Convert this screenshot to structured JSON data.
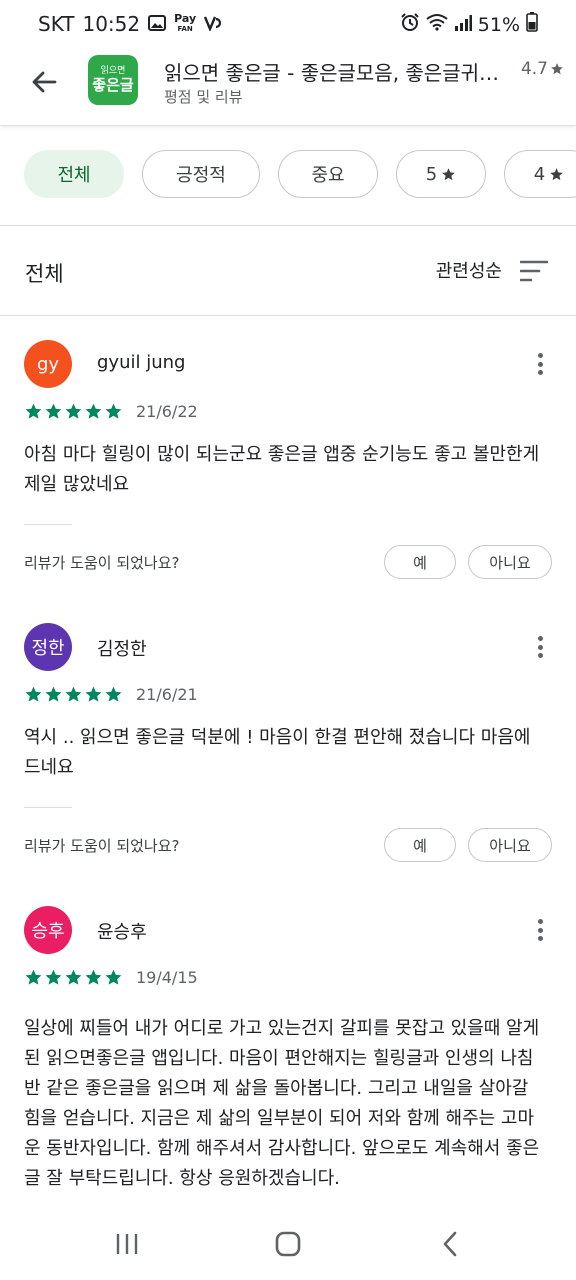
{
  "status_bar": {
    "carrier": "SKT",
    "time": "10:52",
    "pay_line1": "Pay",
    "pay_line2": "FAN",
    "battery": "51%"
  },
  "header": {
    "app_title": "읽으면 좋은글 - 좋은글모음, 좋은글귀, 명언",
    "subtitle": "평점 및 리뷰",
    "rating": "4.7",
    "app_icon_line1": "읽으면",
    "app_icon_line2": "좋은글"
  },
  "chips": [
    {
      "label": "전체",
      "selected": true
    },
    {
      "label": "긍정적"
    },
    {
      "label": "중요"
    },
    {
      "label": "5"
    },
    {
      "label": "4"
    }
  ],
  "sort": {
    "title": "전체",
    "label": "관련성순"
  },
  "helpful": {
    "question": "리뷰가 도움이 되었나요?",
    "yes": "예",
    "no": "아니요"
  },
  "reviews": [
    {
      "avatar_text": "gy",
      "avatar_color": "#f4511e",
      "name": "gyuil jung",
      "rating": 5,
      "date": "21/6/22",
      "text": "아침 마다 힐링이 많이 되는군요 좋은글 앱중 순기능도 좋고 볼만한게 제일 많았네요"
    },
    {
      "avatar_text": "정한",
      "avatar_color": "#5e35b1",
      "name": "김정한",
      "rating": 5,
      "date": "21/6/21",
      "text": "역시 .. 읽으면 좋은글 덕분에 ! 마음이 한결 편안해 졌습니다 마음에 드네요"
    },
    {
      "avatar_text": "승후",
      "avatar_color": "#e91e63",
      "name": "윤승후",
      "rating": 5,
      "date": "19/4/15",
      "text": "일상에 찌들어 내가 어디로 가고 있는건지 갈피를 못잡고 있을때 알게된 읽으면좋은글 앱입니다. 마음이 편안해지는 힐링글과 인생의 나침반 같은 좋은글을 읽으며 제 삶을 돌아봅니다. 그리고 내일을 살아갈 힘을 얻습니다. 지금은 제 삶의 일부분이 되어 저와 함께 해주는 고마운 동반자입니다. 함께 해주셔서 감사합니다. 앞으로도 계속해서 좋은글 잘 부탁드립니다. 항상 응원하겠습니다."
    }
  ],
  "colors": {
    "accent": "#01875f",
    "chip_selected_bg": "#e6f4ea",
    "chip_selected_text": "#0d652d"
  }
}
